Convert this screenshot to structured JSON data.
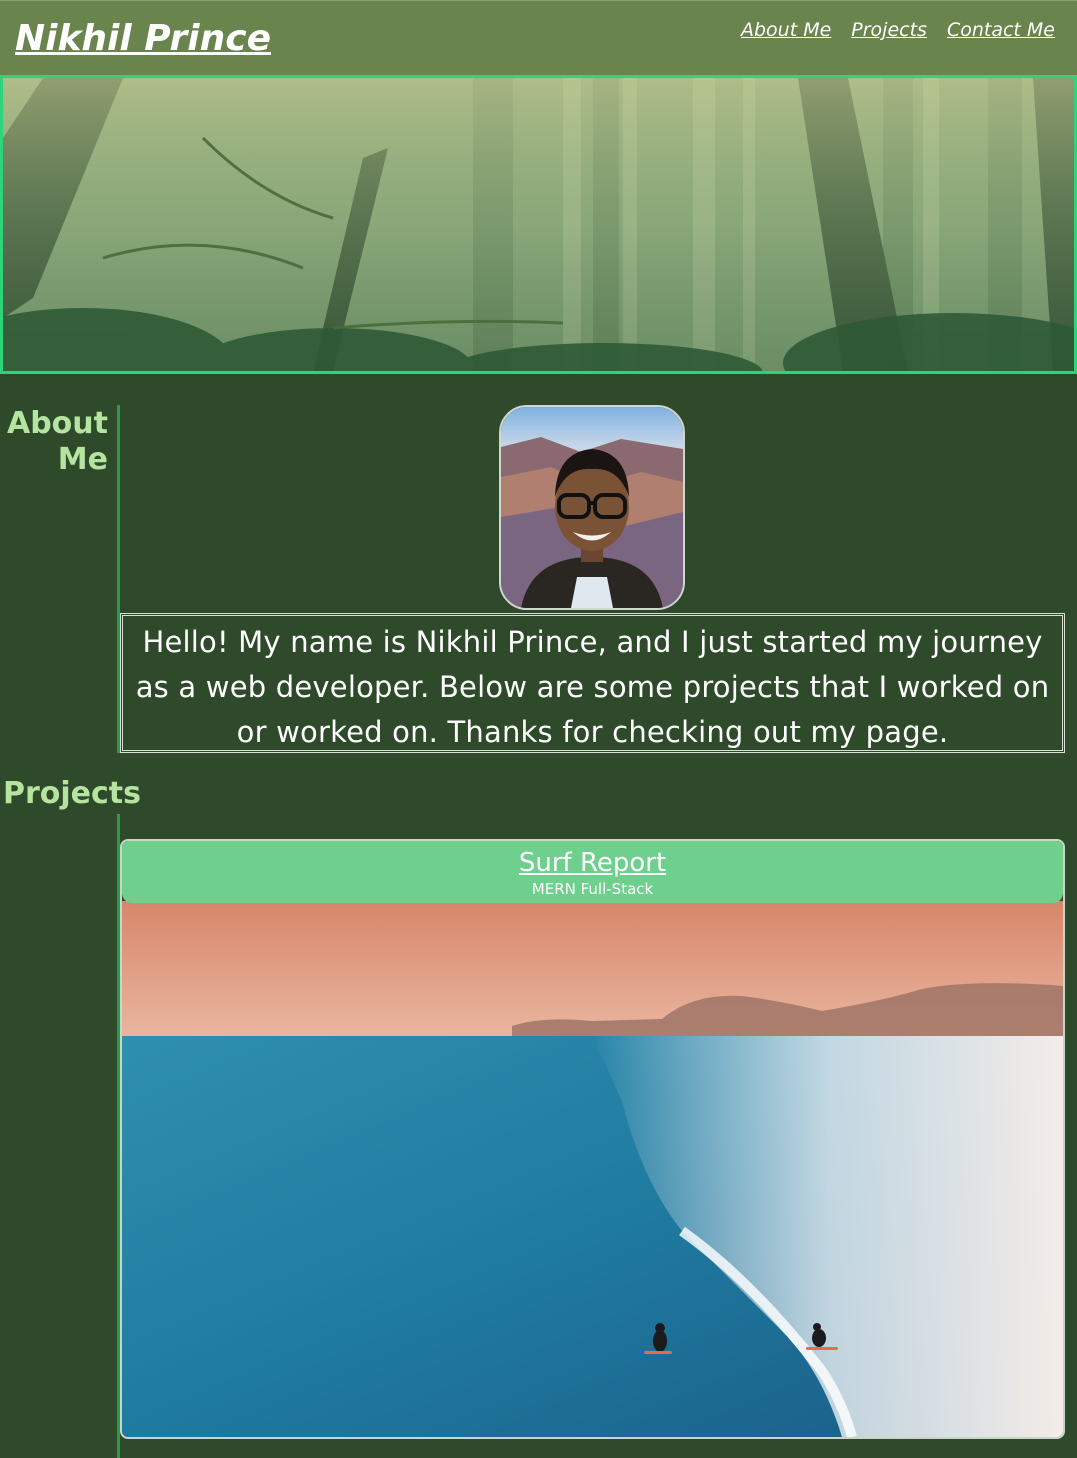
{
  "header": {
    "title": "Nikhil Prince",
    "nav": [
      "About Me",
      "Projects",
      "Contact Me"
    ]
  },
  "about": {
    "label_line1": "About",
    "label_line2": "Me",
    "bio": "Hello! My name is Nikhil Prince, and I just started my journey as a web developer. Below are some projects that I worked on or worked on. Thanks for checking out my page."
  },
  "projects": {
    "label": "Projects",
    "items": [
      {
        "title": "Surf Report",
        "subtitle": "MERN Full-Stack"
      }
    ]
  },
  "colors": {
    "background": "#2e4a2b",
    "header": "#6a844d",
    "accent": "#2ed47a",
    "label": "#b5e3a0",
    "project_header": "#6fd08e"
  }
}
